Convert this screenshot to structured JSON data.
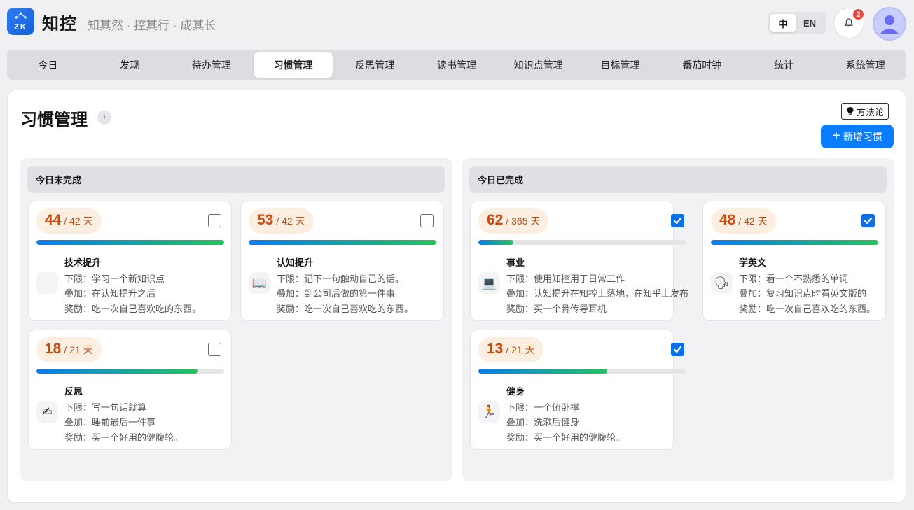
{
  "app": {
    "logo_text": "ZK",
    "name": "知控",
    "tagline": "知其然 · 控其行 · 成其长",
    "lang": {
      "zh": "中",
      "en": "EN"
    },
    "notifications": "2"
  },
  "nav": [
    "今日",
    "发现",
    "待办管理",
    "习惯管理",
    "反思管理",
    "读书管理",
    "知识点管理",
    "目标管理",
    "番茄时钟",
    "统计",
    "系统管理"
  ],
  "page": {
    "title": "习惯管理",
    "info": "i",
    "method_label": "方法论",
    "add_label": "新增习惯"
  },
  "columns": {
    "incomplete": {
      "title": "今日未完成",
      "habits": [
        {
          "streak": "44",
          "total": "/ 42 天",
          "progress": 1.0,
          "icon": "blank-icon",
          "emoji": "",
          "name": "技术提升",
          "lower": "下限：学习一个新知识点",
          "stack": "叠加：在认知提升之后",
          "reward": "奖励：吃一次自己喜欢吃的东西。"
        },
        {
          "streak": "53",
          "total": "/ 42 天",
          "progress": 1.0,
          "icon": "book-icon",
          "emoji": "📖",
          "name": "认知提升",
          "lower": "下限：记下一句触动自己的话。",
          "stack": "叠加：到公司后做的第一件事",
          "reward": "奖励：吃一次自己喜欢吃的东西。"
        },
        {
          "streak": "18",
          "total": "/ 21 天",
          "progress": 0.857,
          "icon": "writing-hand-icon",
          "emoji": "✍",
          "name": "反思",
          "lower": "下限：写一句话就算",
          "stack": "叠加：睡前最后一件事",
          "reward": "奖励：买一个好用的健腹轮。"
        }
      ]
    },
    "complete": {
      "title": "今日已完成",
      "habits": [
        {
          "streak": "62",
          "total": "/ 365 天",
          "progress": 0.17,
          "icon": "laptop-icon",
          "emoji": "💻",
          "name": "事业",
          "lower": "下限：使用知控用于日常工作",
          "stack": "叠加：认知提升在知控上落地，在知乎上发布",
          "reward": "奖励：买一个骨传导耳机"
        },
        {
          "streak": "48",
          "total": "/ 42 天",
          "progress": 1.0,
          "icon": "speaking-head-icon",
          "emoji": "🗣",
          "name": "学英文",
          "lower": "下限：看一个不熟悉的单词",
          "stack": "叠加：复习知识点时看英文版的",
          "reward": "奖励：吃一次自己喜欢吃的东西。"
        },
        {
          "streak": "13",
          "total": "/ 21 天",
          "progress": 0.619,
          "icon": "running-icon",
          "emoji": "🏃",
          "name": "健身",
          "lower": "下限：一个俯卧撑",
          "stack": "叠加：洗漱后健身",
          "reward": "奖励：买一个好用的健腹轮。"
        }
      ]
    }
  },
  "colors": {
    "accent": "#0a7cff",
    "streak_text": "#c94a0c",
    "streak_bg": "#fdeee2",
    "badge": "#e8453c"
  }
}
